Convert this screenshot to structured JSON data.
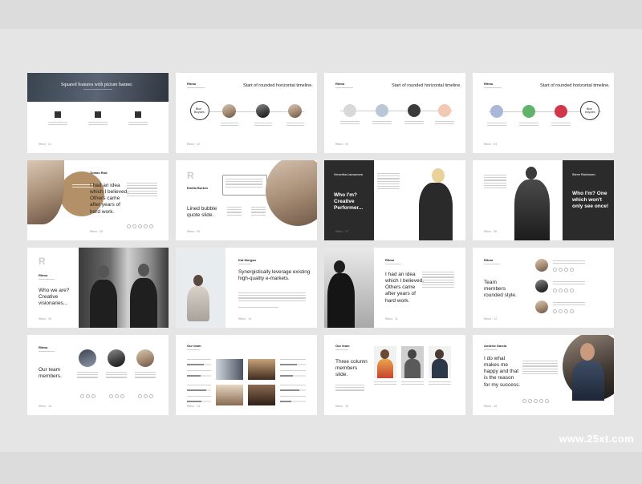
{
  "watermark": "www.25xt.com",
  "slides": {
    "s1": {
      "banner_title": "Squared features with picture banner."
    },
    "s2": {
      "brand": "Ritmo",
      "title": "Start of rounded horizontal timeline.",
      "badge_1": "Blue",
      "badge_2": "Bicycles"
    },
    "s3": {
      "brand": "Ritmo",
      "title": "Start of rounded horizontal timeline."
    },
    "s4": {
      "brand": "Ritmo",
      "title": "Start of rounded horizontal timeline.",
      "badge_1": "Blue",
      "badge_2": "bicycles"
    },
    "s5": {
      "name": "Tomas Rod",
      "quote": "I had an idea which I believed. Others came after years of hard work."
    },
    "s6": {
      "name": "Emilia Burton",
      "quote": "Lined bubble quote slide."
    },
    "s7": {
      "name": "Veronika Lamonova",
      "quote": "Who I'm? Creative Performer..."
    },
    "s8": {
      "name": "Steve Robinson",
      "quote": "Who I'm? One which won't only see once!"
    },
    "s9": {
      "brand": "Ritmo",
      "quote": "Who we are? Creative visionaries..."
    },
    "s10": {
      "name": "Kat Morgan",
      "quote": "Synergistically leverage existing high-quality e-markets."
    },
    "s11": {
      "brand": "Ritmo",
      "quote": "I had an idea which I believed. Others came after years of hard work."
    },
    "s12": {
      "brand": "Ritmo",
      "quote": "Team members rounded style."
    },
    "s13": {
      "brand": "Ritmo",
      "quote": "Our team members."
    },
    "s14": {
      "title": "Our team"
    },
    "s15": {
      "title": "Our team",
      "quote": "Three column members slide."
    },
    "s16": {
      "name": "Andrew Garcia",
      "quote": "I do what makes me happy and that is the reason for my success."
    }
  }
}
